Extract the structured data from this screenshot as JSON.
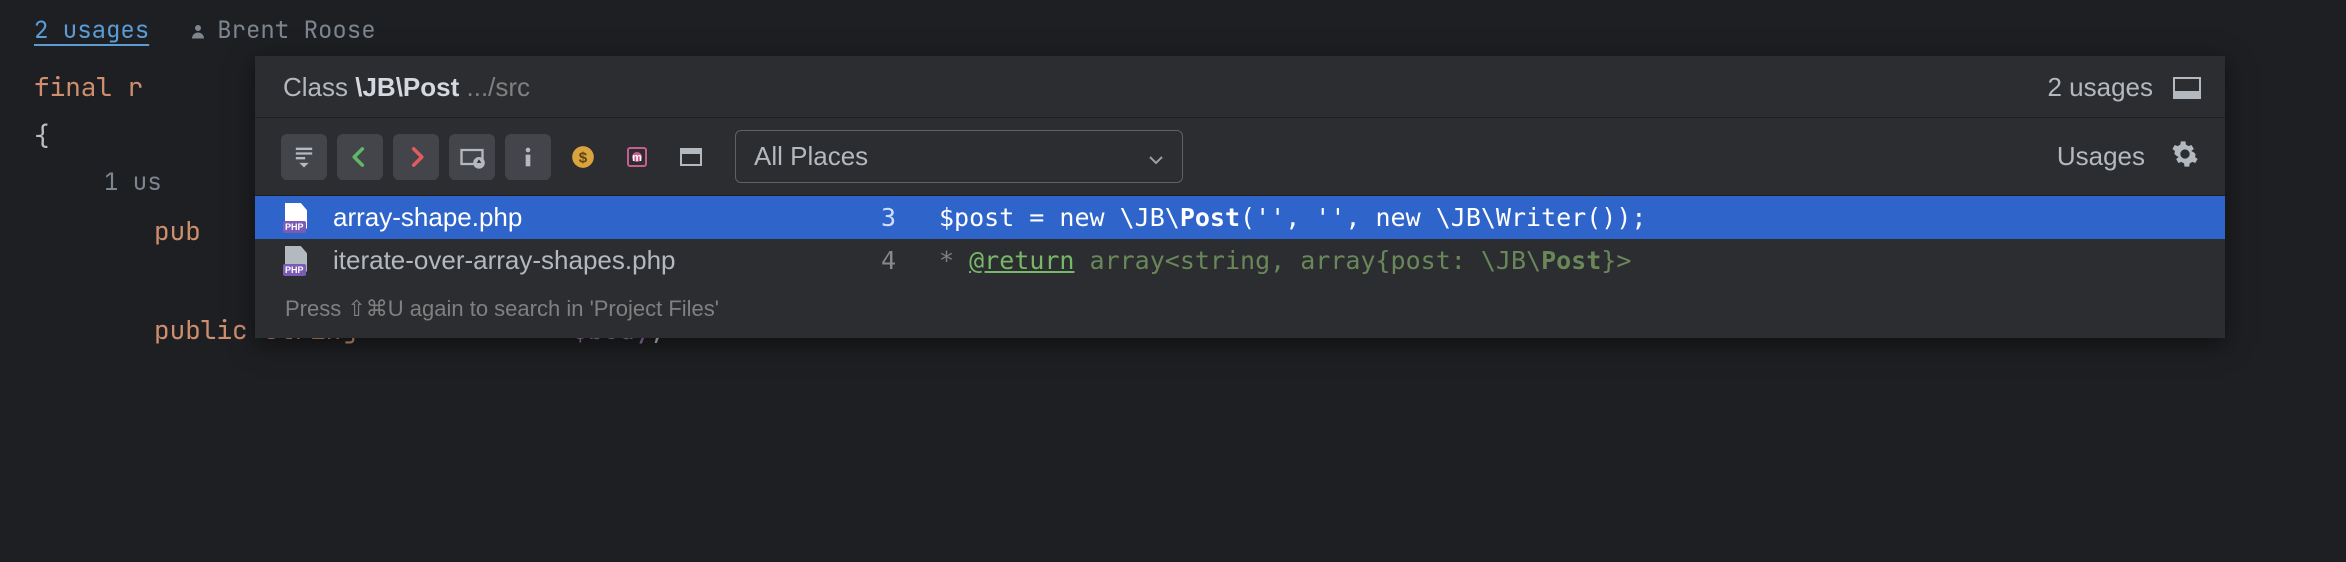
{
  "inlay": {
    "usages_link": "2 usages",
    "author": "Brent Roose"
  },
  "code": {
    "final_keyword": "final ",
    "r_partial": "r",
    "brace": "{",
    "one_usage": "1 us",
    "pub_partial": "pub",
    "public": "public ",
    "string": "string ",
    "body_var": "$body",
    "comma": ","
  },
  "popup": {
    "title_prefix": "Class ",
    "title_class": "\\JB\\Post",
    "title_path": " .../src",
    "usages_count": "2 usages",
    "scope": "All Places",
    "usages_tab": "Usages",
    "results": [
      {
        "filename": "array-shape.php",
        "line": "3",
        "code_plain": "$post = new \\JB\\",
        "code_hl": "Post",
        "code_tail": "('', '', new \\JB\\Writer());",
        "selected": true
      },
      {
        "filename": "iterate-over-array-shapes.php",
        "line": "4",
        "doc_star": "* ",
        "doc_tag": "@return",
        "doc_pre": " array<string, array{post: \\JB\\",
        "doc_hl": "Post",
        "doc_post": "}>",
        "selected": false
      }
    ],
    "footer_hint": "Press ⇧⌘U again to search in 'Project Files'"
  }
}
